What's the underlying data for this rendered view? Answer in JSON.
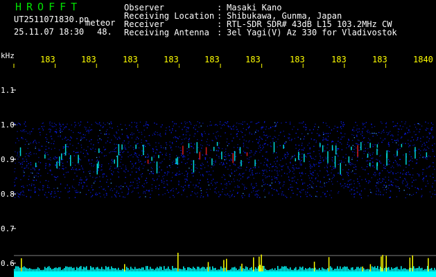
{
  "header": {
    "brand": "HROFFT",
    "filename": "UT2511071830.pn",
    "meteor_label": "meteor",
    "datetime": "25.11.07 18:30",
    "count": "48.",
    "fields": [
      {
        "label": "Observer",
        "sep": ":",
        "value": "Masaki Kano"
      },
      {
        "label": "Receiving Location",
        "sep": ":",
        "value": "Shibukawa, Gunma, Japan"
      },
      {
        "label": "Receiver",
        "sep": ":",
        "value": "RTL-SDR SDR# 43dB L15 103.2MHz CW"
      },
      {
        "label": "Receiving Antenna",
        "sep": ":",
        "value": "3el Yagi(V) Az 330 for Vladivostok"
      }
    ]
  },
  "chart_data": {
    "type": "heatmap",
    "y_unit": "kHz",
    "y_ticks": [
      "1.1",
      "1.0",
      "0.9",
      "0.8",
      "0.7",
      "0.6"
    ],
    "x_ticks": [
      "183",
      "183",
      "183",
      "183",
      "183",
      "183",
      "183",
      "183",
      "183",
      "1840"
    ],
    "signal_band_khz": [
      0.79,
      1.01
    ],
    "colors": {
      "background": "#000000",
      "noise": "#0a1cff",
      "echo": "#00ffff",
      "strong": "#ff2020",
      "meter": "#00ffff",
      "meter_peak": "#ffff00",
      "tick": "#ffffff",
      "x_label": "#ffff00"
    }
  }
}
